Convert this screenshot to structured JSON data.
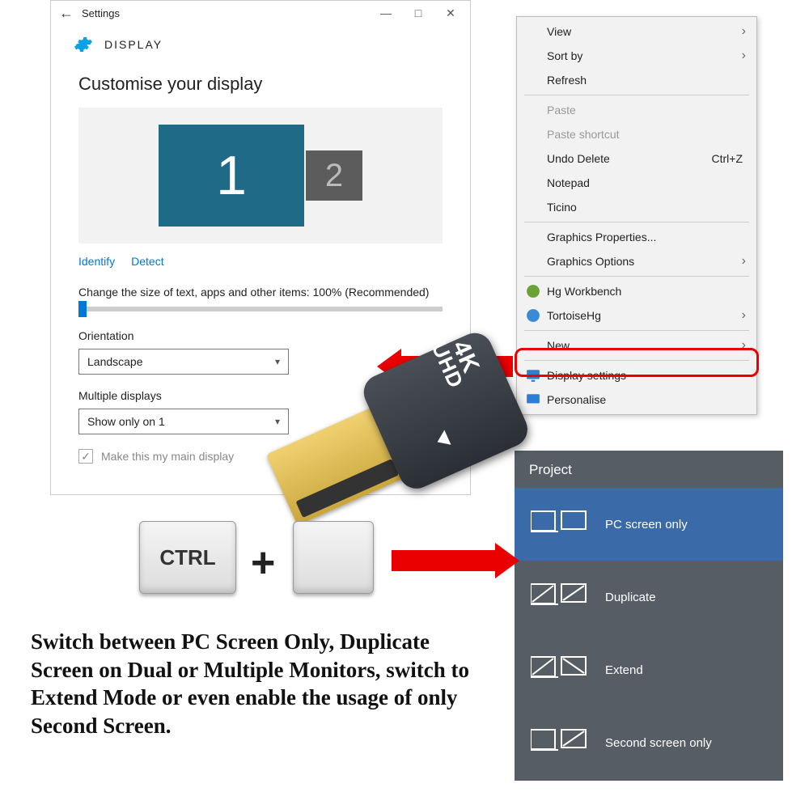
{
  "settings": {
    "window_title": "Settings",
    "section": "DISPLAY",
    "heading": "Customise your display",
    "monitor1": "1",
    "monitor2": "2",
    "identify": "Identify",
    "detect": "Detect",
    "scale_label": "Change the size of text, apps and other items: 100% (Recommended)",
    "orientation_label": "Orientation",
    "orientation_value": "Landscape",
    "multi_label": "Multiple displays",
    "multi_value": "Show only on 1",
    "main_display": "Make this my main display"
  },
  "context_menu": {
    "view": "View",
    "sort": "Sort by",
    "refresh": "Refresh",
    "paste": "Paste",
    "paste_shortcut": "Paste shortcut",
    "undo": "Undo Delete",
    "undo_key": "Ctrl+Z",
    "notepad": "Notepad",
    "ticino": "Ticino",
    "gfx_props": "Graphics Properties...",
    "gfx_opts": "Graphics Options",
    "hg_wb": "Hg Workbench",
    "tortoise": "TortoiseHg",
    "new": "New",
    "display_settings": "Display settings",
    "personalise": "Personalise"
  },
  "project": {
    "title": "Project",
    "pc_only": "PC screen only",
    "duplicate": "Duplicate",
    "extend": "Extend",
    "second_only": "Second screen only"
  },
  "keys": {
    "ctrl": "CTRL",
    "plus": "+"
  },
  "dongle": {
    "line1": "4K",
    "line2": "UHD"
  },
  "caption": "Switch between PC Screen Only, Duplicate Screen on Dual or Multiple Monitors, switch to Extend Mode or even enable the usage of only Second Screen."
}
